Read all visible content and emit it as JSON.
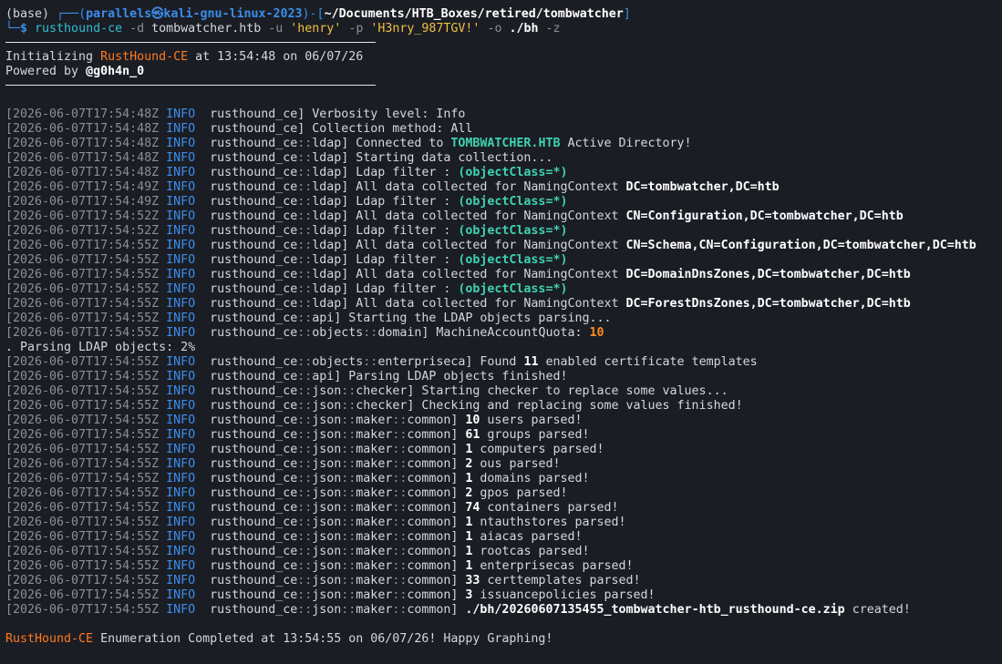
{
  "prompt": {
    "env": "(base) ",
    "box_top": "┌──(",
    "user_host": "parallels㉿kali-gnu-linux-2023",
    "mid": ")-[",
    "path": "~/Documents/HTB_Boxes/retired/tombwatcher",
    "end": "]",
    "box_bottom": "└─",
    "dollar": "$ ",
    "cmd": "rusthound-ce",
    "args": [
      " -d ",
      "tombwatcher.htb",
      " -u ",
      "'henry'",
      " -p ",
      "'H3nry_987TGV!'",
      " -o ",
      "./bh",
      " -z"
    ]
  },
  "banner": {
    "init_prefix": "Initializing ",
    "app_name": "RustHound-CE",
    "init_suffix": " at 13:54:48 on 06/07/26",
    "powered_prefix": "Powered by ",
    "author": "@g0h4n_0"
  },
  "log": [
    {
      "ts": "[2026-06-07T17:54:48Z ",
      "lvl": "INFO ",
      "mod": " rusthound_ce",
      "msg": [
        {
          "t": "] Verbosity level: Info"
        }
      ]
    },
    {
      "ts": "[2026-06-07T17:54:48Z ",
      "lvl": "INFO ",
      "mod": " rusthound_ce",
      "msg": [
        {
          "t": "] Collection method: All"
        }
      ]
    },
    {
      "ts": "[2026-06-07T17:54:48Z ",
      "lvl": "INFO ",
      "mod": " rusthound_ce::ldap",
      "msg": [
        {
          "t": "] Connected to "
        },
        {
          "t": "TOMBWATCHER.HTB",
          "s": "emph-green"
        },
        {
          "t": " Active Directory!"
        }
      ]
    },
    {
      "ts": "[2026-06-07T17:54:48Z ",
      "lvl": "INFO ",
      "mod": " rusthound_ce::ldap",
      "msg": [
        {
          "t": "] Starting data collection..."
        }
      ]
    },
    {
      "ts": "[2026-06-07T17:54:48Z ",
      "lvl": "INFO ",
      "mod": " rusthound_ce::ldap",
      "msg": [
        {
          "t": "] Ldap filter : "
        },
        {
          "t": "(objectClass=*)",
          "s": "emph-green"
        }
      ]
    },
    {
      "ts": "[2026-06-07T17:54:49Z ",
      "lvl": "INFO ",
      "mod": " rusthound_ce::ldap",
      "msg": [
        {
          "t": "] All data collected for NamingContext "
        },
        {
          "t": "DC=tombwatcher,DC=htb",
          "s": "emph"
        }
      ]
    },
    {
      "ts": "[2026-06-07T17:54:49Z ",
      "lvl": "INFO ",
      "mod": " rusthound_ce::ldap",
      "msg": [
        {
          "t": "] Ldap filter : "
        },
        {
          "t": "(objectClass=*)",
          "s": "emph-green"
        }
      ]
    },
    {
      "ts": "[2026-06-07T17:54:52Z ",
      "lvl": "INFO ",
      "mod": " rusthound_ce::ldap",
      "msg": [
        {
          "t": "] All data collected for NamingContext "
        },
        {
          "t": "CN=Configuration,DC=tombwatcher,DC=htb",
          "s": "emph"
        }
      ]
    },
    {
      "ts": "[2026-06-07T17:54:52Z ",
      "lvl": "INFO ",
      "mod": " rusthound_ce::ldap",
      "msg": [
        {
          "t": "] Ldap filter : "
        },
        {
          "t": "(objectClass=*)",
          "s": "emph-green"
        }
      ]
    },
    {
      "ts": "[2026-06-07T17:54:55Z ",
      "lvl": "INFO ",
      "mod": " rusthound_ce::ldap",
      "msg": [
        {
          "t": "] All data collected for NamingContext "
        },
        {
          "t": "CN=Schema,CN=Configuration,DC=tombwatcher,DC=htb",
          "s": "emph"
        }
      ]
    },
    {
      "ts": "[2026-06-07T17:54:55Z ",
      "lvl": "INFO ",
      "mod": " rusthound_ce::ldap",
      "msg": [
        {
          "t": "] Ldap filter : "
        },
        {
          "t": "(objectClass=*)",
          "s": "emph-green"
        }
      ]
    },
    {
      "ts": "[2026-06-07T17:54:55Z ",
      "lvl": "INFO ",
      "mod": " rusthound_ce::ldap",
      "msg": [
        {
          "t": "] All data collected for NamingContext "
        },
        {
          "t": "DC=DomainDnsZones,DC=tombwatcher,DC=htb",
          "s": "emph"
        }
      ]
    },
    {
      "ts": "[2026-06-07T17:54:55Z ",
      "lvl": "INFO ",
      "mod": " rusthound_ce::ldap",
      "msg": [
        {
          "t": "] Ldap filter : "
        },
        {
          "t": "(objectClass=*)",
          "s": "emph-green"
        }
      ]
    },
    {
      "ts": "[2026-06-07T17:54:55Z ",
      "lvl": "INFO ",
      "mod": " rusthound_ce::ldap",
      "msg": [
        {
          "t": "] All data collected for NamingContext "
        },
        {
          "t": "DC=ForestDnsZones,DC=tombwatcher,DC=htb",
          "s": "emph"
        }
      ]
    },
    {
      "ts": "[2026-06-07T17:54:55Z ",
      "lvl": "INFO ",
      "mod": " rusthound_ce::api",
      "msg": [
        {
          "t": "] Starting the LDAP objects parsing..."
        }
      ]
    },
    {
      "ts": "[2026-06-07T17:54:55Z ",
      "lvl": "INFO ",
      "mod": " rusthound_ce::objects::domain",
      "msg": [
        {
          "t": "] MachineAccountQuota: "
        },
        {
          "t": "10",
          "s": "emph-orange"
        }
      ]
    },
    {
      "plain": ". Parsing LDAP objects: 2%"
    },
    {
      "ts": "[2026-06-07T17:54:55Z ",
      "lvl": "INFO ",
      "mod": " rusthound_ce::objects::enterpriseca",
      "msg": [
        {
          "t": "] Found "
        },
        {
          "t": "11",
          "s": "emph"
        },
        {
          "t": " enabled certificate templates"
        }
      ]
    },
    {
      "ts": "[2026-06-07T17:54:55Z ",
      "lvl": "INFO ",
      "mod": " rusthound_ce::api",
      "msg": [
        {
          "t": "] Parsing LDAP objects finished!"
        }
      ]
    },
    {
      "ts": "[2026-06-07T17:54:55Z ",
      "lvl": "INFO ",
      "mod": " rusthound_ce::json::checker",
      "msg": [
        {
          "t": "] Starting checker to replace some values..."
        }
      ]
    },
    {
      "ts": "[2026-06-07T17:54:55Z ",
      "lvl": "INFO ",
      "mod": " rusthound_ce::json::checker",
      "msg": [
        {
          "t": "] Checking and replacing some values finished!"
        }
      ]
    },
    {
      "ts": "[2026-06-07T17:54:55Z ",
      "lvl": "INFO ",
      "mod": " rusthound_ce::json::maker::common",
      "msg": [
        {
          "t": "] "
        },
        {
          "t": "10",
          "s": "emph"
        },
        {
          "t": " users parsed!"
        }
      ]
    },
    {
      "ts": "[2026-06-07T17:54:55Z ",
      "lvl": "INFO ",
      "mod": " rusthound_ce::json::maker::common",
      "msg": [
        {
          "t": "] "
        },
        {
          "t": "61",
          "s": "emph"
        },
        {
          "t": " groups parsed!"
        }
      ]
    },
    {
      "ts": "[2026-06-07T17:54:55Z ",
      "lvl": "INFO ",
      "mod": " rusthound_ce::json::maker::common",
      "msg": [
        {
          "t": "] "
        },
        {
          "t": "1",
          "s": "emph"
        },
        {
          "t": " computers parsed!"
        }
      ]
    },
    {
      "ts": "[2026-06-07T17:54:55Z ",
      "lvl": "INFO ",
      "mod": " rusthound_ce::json::maker::common",
      "msg": [
        {
          "t": "] "
        },
        {
          "t": "2",
          "s": "emph"
        },
        {
          "t": " ous parsed!"
        }
      ]
    },
    {
      "ts": "[2026-06-07T17:54:55Z ",
      "lvl": "INFO ",
      "mod": " rusthound_ce::json::maker::common",
      "msg": [
        {
          "t": "] "
        },
        {
          "t": "1",
          "s": "emph"
        },
        {
          "t": " domains parsed!"
        }
      ]
    },
    {
      "ts": "[2026-06-07T17:54:55Z ",
      "lvl": "INFO ",
      "mod": " rusthound_ce::json::maker::common",
      "msg": [
        {
          "t": "] "
        },
        {
          "t": "2",
          "s": "emph"
        },
        {
          "t": " gpos parsed!"
        }
      ]
    },
    {
      "ts": "[2026-06-07T17:54:55Z ",
      "lvl": "INFO ",
      "mod": " rusthound_ce::json::maker::common",
      "msg": [
        {
          "t": "] "
        },
        {
          "t": "74",
          "s": "emph"
        },
        {
          "t": " containers parsed!"
        }
      ]
    },
    {
      "ts": "[2026-06-07T17:54:55Z ",
      "lvl": "INFO ",
      "mod": " rusthound_ce::json::maker::common",
      "msg": [
        {
          "t": "] "
        },
        {
          "t": "1",
          "s": "emph"
        },
        {
          "t": " ntauthstores parsed!"
        }
      ]
    },
    {
      "ts": "[2026-06-07T17:54:55Z ",
      "lvl": "INFO ",
      "mod": " rusthound_ce::json::maker::common",
      "msg": [
        {
          "t": "] "
        },
        {
          "t": "1",
          "s": "emph"
        },
        {
          "t": " aiacas parsed!"
        }
      ]
    },
    {
      "ts": "[2026-06-07T17:54:55Z ",
      "lvl": "INFO ",
      "mod": " rusthound_ce::json::maker::common",
      "msg": [
        {
          "t": "] "
        },
        {
          "t": "1",
          "s": "emph"
        },
        {
          "t": " rootcas parsed!"
        }
      ]
    },
    {
      "ts": "[2026-06-07T17:54:55Z ",
      "lvl": "INFO ",
      "mod": " rusthound_ce::json::maker::common",
      "msg": [
        {
          "t": "] "
        },
        {
          "t": "1",
          "s": "emph"
        },
        {
          "t": " enterprisecas parsed!"
        }
      ]
    },
    {
      "ts": "[2026-06-07T17:54:55Z ",
      "lvl": "INFO ",
      "mod": " rusthound_ce::json::maker::common",
      "msg": [
        {
          "t": "] "
        },
        {
          "t": "33",
          "s": "emph"
        },
        {
          "t": " certtemplates parsed!"
        }
      ]
    },
    {
      "ts": "[2026-06-07T17:54:55Z ",
      "lvl": "INFO ",
      "mod": " rusthound_ce::json::maker::common",
      "msg": [
        {
          "t": "] "
        },
        {
          "t": "3",
          "s": "emph"
        },
        {
          "t": " issuancepolicies parsed!"
        }
      ]
    },
    {
      "ts": "[2026-06-07T17:54:55Z ",
      "lvl": "INFO ",
      "mod": " rusthound_ce::json::maker::common",
      "msg": [
        {
          "t": "] "
        },
        {
          "t": "./bh/20260607135455_tombwatcher-htb_rusthound-ce.zip",
          "s": "emph"
        },
        {
          "t": " created!"
        }
      ]
    }
  ],
  "footer": {
    "app_name": "RustHound-CE",
    "text": " Enumeration Completed at 13:54:55 on 06/07/26! Happy Graphing!"
  },
  "colors": {
    "background": "#1b1d25",
    "text": "#d5d7dc",
    "info": "#3b8eea",
    "highlight_green": "#3fd3b0",
    "highlight_orange": "#ff8c1a",
    "brand_orange": "#ff7a1a"
  }
}
